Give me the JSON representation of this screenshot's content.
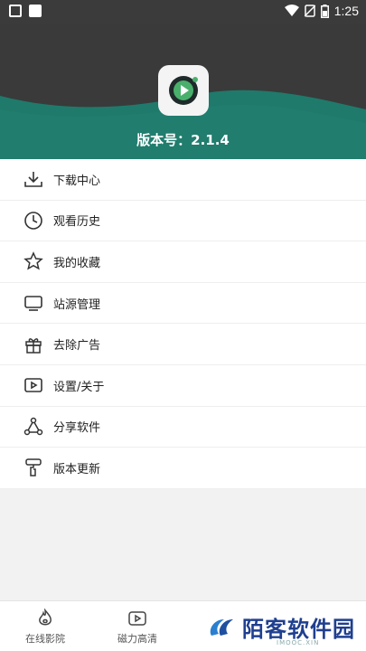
{
  "status_bar": {
    "time": "1:25"
  },
  "header": {
    "version_label": "版本号：2.1.4"
  },
  "menu": {
    "items": [
      {
        "label": "下载中心",
        "icon": "download-icon"
      },
      {
        "label": "观看历史",
        "icon": "clock-icon"
      },
      {
        "label": "我的收藏",
        "icon": "star-icon"
      },
      {
        "label": "站源管理",
        "icon": "monitor-icon"
      },
      {
        "label": "去除广告",
        "icon": "gift-icon"
      },
      {
        "label": "设置/关于",
        "icon": "play-box-icon"
      },
      {
        "label": "分享软件",
        "icon": "share-icon"
      },
      {
        "label": "版本更新",
        "icon": "brush-icon"
      }
    ]
  },
  "bottom_nav": {
    "items": [
      {
        "label": "在线影院",
        "icon": "flame-icon"
      },
      {
        "label": "磁力高清",
        "icon": "play-box-icon"
      }
    ]
  },
  "watermark": {
    "text": "陌客软件园",
    "sub": "IMOOC.XIN"
  },
  "colors": {
    "header_bg": "#3a3a3a",
    "wave_teal": "#1f7a6b",
    "logo_green": "#2e8b5e"
  }
}
